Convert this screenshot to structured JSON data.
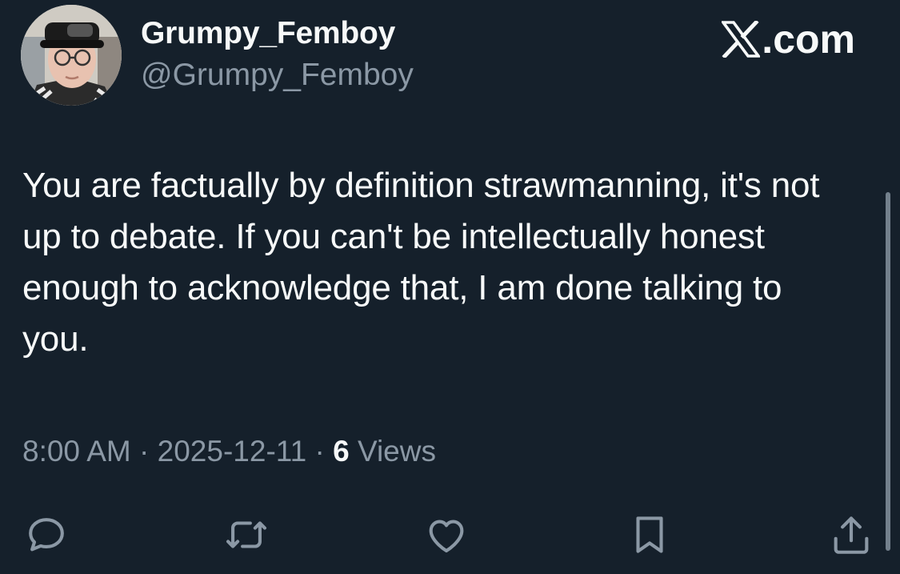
{
  "author": {
    "display_name": "Grumpy_Femboy",
    "handle": "@Grumpy_Femboy"
  },
  "branding": {
    "site_label": ".com",
    "icon": "x-logo"
  },
  "tweet": {
    "text": "You are factually by definition strawmanning, it's not up to debate. If you can't be intellectually honest enough to acknowledge that, I am done talking to you.",
    "time": "8:00 AM",
    "separator": "·",
    "date": "2025-12-11",
    "views_count": "6",
    "views_label": "Views"
  },
  "actions": [
    {
      "name": "reply",
      "icon": "reply-icon"
    },
    {
      "name": "retweet",
      "icon": "retweet-icon"
    },
    {
      "name": "like",
      "icon": "heart-icon"
    },
    {
      "name": "bookmark",
      "icon": "bookmark-icon"
    },
    {
      "name": "share",
      "icon": "share-icon"
    }
  ],
  "colors": {
    "background": "#15202b",
    "text": "#f7f9f9",
    "secondary_text": "#8b98a5",
    "icon": "#8b98a5"
  }
}
